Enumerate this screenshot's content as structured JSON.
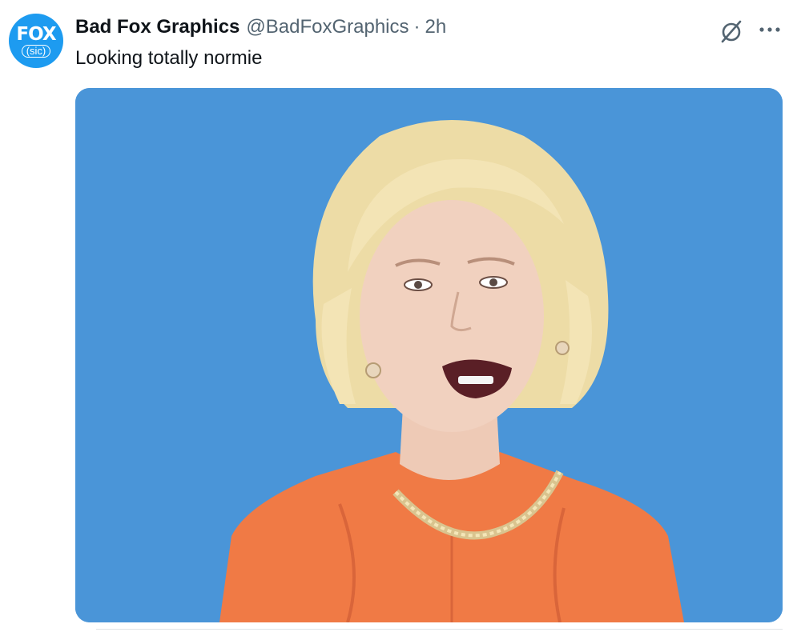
{
  "tweet": {
    "avatar": {
      "logo_main": "FOX",
      "logo_sub": "(sic)"
    },
    "display_name": "Bad Fox Graphics",
    "handle": "@BadFoxGraphics",
    "separator": "·",
    "time": "2h",
    "text": "Looking totally normie",
    "icons": {
      "grok": "grok-icon",
      "more": "more-options-icon"
    },
    "colors": {
      "brand": "#1d9bf0",
      "media_background": "#4a95d8",
      "jacket": "#f07a45",
      "secondary_text": "#536471"
    }
  }
}
